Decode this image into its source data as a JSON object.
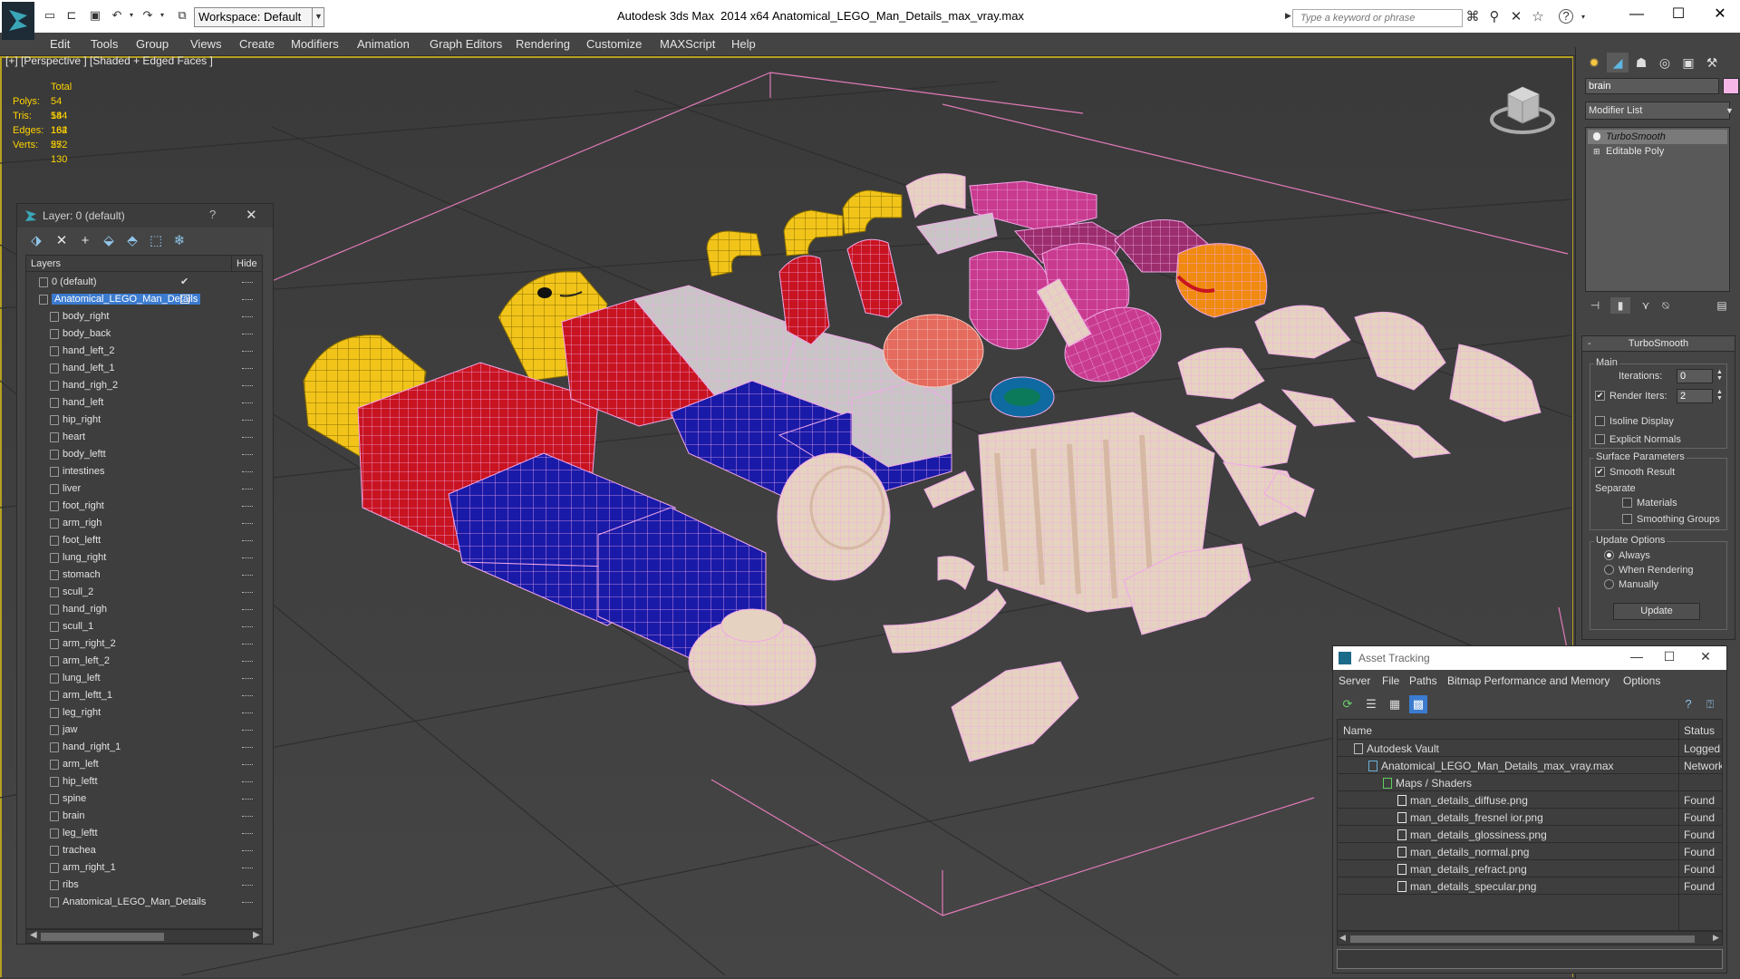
{
  "titlebar": {
    "workspace_label": "Workspace: Default",
    "app_title": "Autodesk 3ds Max  2014 x64",
    "file_title": "Anatomical_LEGO_Man_Details_max_vray.max",
    "search_placeholder": "Type a keyword or phrase",
    "icons": [
      "new-file-icon",
      "open-icon",
      "save-icon",
      "undo-icon",
      "redo-icon",
      "project-icon",
      "binoculars-icon",
      "search-icon",
      "exchange-icon",
      "star-icon",
      "help-icon"
    ]
  },
  "menu": [
    "Edit",
    "Tools",
    "Group",
    "Views",
    "Create",
    "Modifiers",
    "Animation",
    "Graph Editors",
    "Rendering",
    "Customize",
    "MAXScript",
    "Help"
  ],
  "viewport": {
    "label": "[+] [Perspective ] [Shaded + Edged Faces ]",
    "stats": {
      "total_label": "Total",
      "rows": [
        {
          "label": "Polys:",
          "value": "54 184"
        },
        {
          "label": "Tris:",
          "value": "54 184"
        },
        {
          "label": "Edges:",
          "value": "162 552"
        },
        {
          "label": "Verts:",
          "value": "27 130"
        }
      ]
    },
    "colors": {
      "border_active": "#b6a022",
      "wire_pink": "#f0a8e8",
      "yellow": "#f2c41a",
      "red": "#c81420",
      "blue": "#1a1aa8",
      "bone": "#e8d0bc",
      "magenta": "#d82e9e"
    }
  },
  "layer_panel": {
    "title": "Layer: 0 (default)",
    "help": "?",
    "header_layers": "Layers",
    "header_hide": "Hide",
    "items": [
      {
        "label": "0 (default)",
        "level": 1,
        "check": "✔"
      },
      {
        "label": "Anatomical_LEGO_Man_Details",
        "level": 1,
        "selected": true
      },
      {
        "label": "body_right",
        "level": 2
      },
      {
        "label": "body_back",
        "level": 2
      },
      {
        "label": "hand_left_2",
        "level": 2
      },
      {
        "label": "hand_left_1",
        "level": 2
      },
      {
        "label": "hand_righ_2",
        "level": 2
      },
      {
        "label": "hand_left",
        "level": 2
      },
      {
        "label": "hip_right",
        "level": 2
      },
      {
        "label": "heart",
        "level": 2
      },
      {
        "label": "body_leftt",
        "level": 2
      },
      {
        "label": "intestines",
        "level": 2
      },
      {
        "label": "liver",
        "level": 2
      },
      {
        "label": "foot_right",
        "level": 2
      },
      {
        "label": "arm_righ",
        "level": 2
      },
      {
        "label": "foot_leftt",
        "level": 2
      },
      {
        "label": "lung_right",
        "level": 2
      },
      {
        "label": "stomach",
        "level": 2
      },
      {
        "label": "scull_2",
        "level": 2
      },
      {
        "label": "hand_righ",
        "level": 2
      },
      {
        "label": "scull_1",
        "level": 2
      },
      {
        "label": "arm_right_2",
        "level": 2
      },
      {
        "label": "arm_left_2",
        "level": 2
      },
      {
        "label": "lung_left",
        "level": 2
      },
      {
        "label": "arm_leftt_1",
        "level": 2
      },
      {
        "label": "leg_right",
        "level": 2
      },
      {
        "label": "jaw",
        "level": 2
      },
      {
        "label": "hand_right_1",
        "level": 2
      },
      {
        "label": "arm_left",
        "level": 2
      },
      {
        "label": "hip_leftt",
        "level": 2
      },
      {
        "label": "spine",
        "level": 2
      },
      {
        "label": "brain",
        "level": 2
      },
      {
        "label": "leg_leftt",
        "level": 2
      },
      {
        "label": "trachea",
        "level": 2
      },
      {
        "label": "arm_right_1",
        "level": 2
      },
      {
        "label": "ribs",
        "level": 2
      },
      {
        "label": "Anatomical_LEGO_Man_Details",
        "level": 2
      }
    ]
  },
  "command_panel": {
    "object_name": "brain",
    "object_color": "#f6b6e8",
    "modifier_list_label": "Modifier List",
    "stack": [
      {
        "label": "TurboSmooth",
        "italic": true,
        "active": true
      },
      {
        "label": "Editable Poly",
        "italic": false,
        "active": false
      }
    ],
    "turbosmooth": {
      "title": "TurboSmooth",
      "main_label": "Main",
      "iterations_label": "Iterations:",
      "iterations_value": "0",
      "render_iters_label": "Render Iters:",
      "render_iters_value": "2",
      "render_iters_checked": true,
      "isoline_label": "Isoline Display",
      "explicit_normals_label": "Explicit Normals",
      "surface_params_label": "Surface Parameters",
      "smooth_result_label": "Smooth Result",
      "separate_label": "Separate",
      "materials_label": "Materials",
      "smoothing_groups_label": "Smoothing Groups",
      "update_options_label": "Update Options",
      "always_label": "Always",
      "when_rendering_label": "When Rendering",
      "manually_label": "Manually",
      "update_button": "Update"
    }
  },
  "asset_tracking": {
    "title": "Asset Tracking",
    "menu": [
      "Server",
      "File",
      "Paths",
      "Bitmap Performance and Memory",
      "Options"
    ],
    "header_name": "Name",
    "header_status": "Status",
    "rows": [
      {
        "name": "Autodesk Vault",
        "level": 1,
        "status": "Logged O"
      },
      {
        "name": "Anatomical_LEGO_Man_Details_max_vray.max",
        "level": 2,
        "status": "Network"
      },
      {
        "name": "Maps / Shaders",
        "level": 3,
        "status": ""
      },
      {
        "name": "man_details_diffuse.png",
        "level": 4,
        "status": "Found"
      },
      {
        "name": "man_details_fresnel ior.png",
        "level": 4,
        "status": "Found"
      },
      {
        "name": "man_details_glossiness.png",
        "level": 4,
        "status": "Found"
      },
      {
        "name": "man_details_normal.png",
        "level": 4,
        "status": "Found"
      },
      {
        "name": "man_details_refract.png",
        "level": 4,
        "status": "Found"
      },
      {
        "name": "man_details_specular.png",
        "level": 4,
        "status": "Found"
      }
    ]
  }
}
